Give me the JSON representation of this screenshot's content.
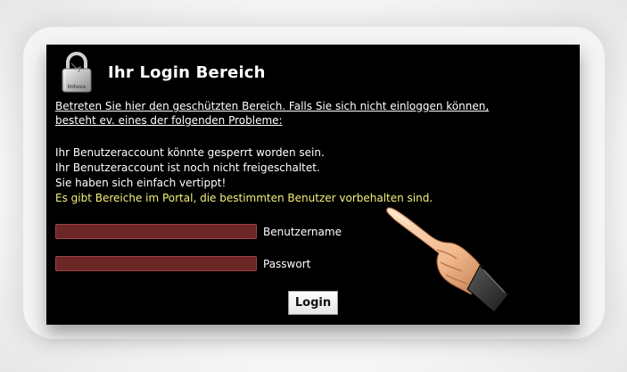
{
  "header": {
    "title": "Ihr Login Bereich",
    "lock_icon_label": "Intoss"
  },
  "intro": {
    "text": "Betreten Sie hier den geschützten Bereich. Falls Sie sich nicht einloggen können, besteht ev. eines der folgenden Probleme:"
  },
  "problems": [
    "Ihr Benutzeraccount könnte gesperrt worden sein.",
    "Ihr Benutzeraccount ist noch nicht freigeschaltet.",
    "Sie haben sich einfach vertippt!",
    "Es gibt Bereiche im Portal, die bestimmten Benutzer vorbehalten sind."
  ],
  "form": {
    "username_label": "Benutzername",
    "username_value": "",
    "password_label": "Passwort",
    "password_value": "",
    "login_label": "Login"
  },
  "colors": {
    "panel_bg": "#000000",
    "field_bg": "#6b2626",
    "highlight_text": "#f3f07a"
  },
  "icons": [
    "lock-icon",
    "pointing-hand-icon"
  ]
}
